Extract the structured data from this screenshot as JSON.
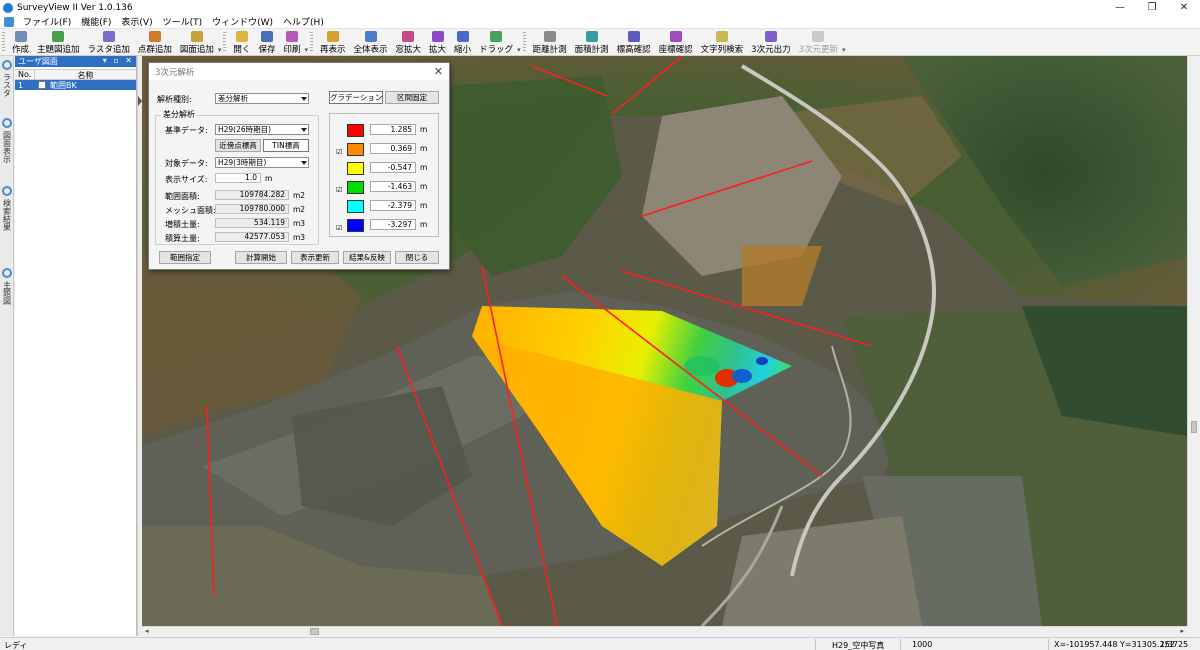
{
  "window": {
    "title": "SurveyView II  Ver 1.0.136",
    "controls": [
      "—",
      "❐",
      "✕"
    ]
  },
  "menu": [
    "ファイル(F)",
    "機能(F)",
    "表示(V)",
    "ツール(T)",
    "ウィンドウ(W)",
    "ヘルプ(H)"
  ],
  "toolbar": {
    "groups": [
      [
        {
          "label": "作成",
          "icon": "new-file-icon",
          "color": "#6f8fb8"
        },
        {
          "label": "主題図追加",
          "icon": "add-map-icon",
          "color": "#4aa04a"
        },
        {
          "label": "ラスタ追加",
          "icon": "add-raster-icon",
          "color": "#7a6cc8"
        },
        {
          "label": "点群追加",
          "icon": "add-pointcloud-icon",
          "color": "#d07a2a"
        },
        {
          "label": "図面追加",
          "icon": "add-drawing-icon",
          "color": "#c9a23a"
        }
      ],
      [
        {
          "label": "開く",
          "icon": "open-folder-icon",
          "color": "#e0b440"
        },
        {
          "label": "保存",
          "icon": "save-icon",
          "color": "#4a6fb8"
        },
        {
          "label": "印刷",
          "icon": "print-icon",
          "color": "#b45ab8"
        }
      ],
      [
        {
          "label": "再表示",
          "icon": "refresh-icon",
          "color": "#d8a030"
        },
        {
          "label": "全体表示",
          "icon": "fit-all-icon",
          "color": "#4a7fc8"
        },
        {
          "label": "窓拡大",
          "icon": "window-zoom-icon",
          "color": "#c84a8a"
        },
        {
          "label": "拡大",
          "icon": "zoom-in-icon",
          "color": "#8a4ac8"
        },
        {
          "label": "縮小",
          "icon": "zoom-out-icon",
          "color": "#4a6ac8"
        },
        {
          "label": "ドラッグ",
          "icon": "pan-drag-icon",
          "color": "#4aa060"
        }
      ],
      [
        {
          "label": "距離計測",
          "icon": "distance-measure-icon",
          "color": "#8a8a8a"
        },
        {
          "label": "面積計測",
          "icon": "area-measure-icon",
          "color": "#3a9aa8"
        },
        {
          "label": "標高確認",
          "icon": "elevation-check-icon",
          "color": "#5a5ac0"
        },
        {
          "label": "座標確認",
          "icon": "coordinate-check-icon",
          "color": "#a04ac0"
        },
        {
          "label": "文字列検索",
          "icon": "text-search-icon",
          "color": "#c8b850"
        },
        {
          "label": "3次元出力",
          "icon": "export-3d-icon",
          "color": "#8060c8"
        },
        {
          "label": "3次元更新",
          "icon": "update-3d-icon",
          "color": "#9a9a9a",
          "disabled": true
        }
      ]
    ]
  },
  "side_tabs": [
    "ラスタ",
    "図面表示",
    "検索結果",
    "主題図"
  ],
  "user_panel": {
    "title": "ユーザ図面",
    "buttons": "▾ ▫ ✕",
    "col_no": "No.",
    "col_name": "名称",
    "rows": [
      {
        "no": "1",
        "name": "範囲BK"
      }
    ]
  },
  "dialog": {
    "title": "3次元解析",
    "analysis_type_label": "解析種別:",
    "analysis_type_value": "差分解析",
    "tab_gradation": "グラデーション",
    "tab_zone_fixed": "区間固定",
    "section_title": "差分解析",
    "base_data_label": "基準データ:",
    "base_data_value": "H29(26時期目)",
    "nearest_elevation": "近傍点標高",
    "tin_elevation": "TIN標高",
    "target_data_label": "対象データ:",
    "target_data_value": "H29(3時期目)",
    "display_size_label": "表示サイズ:",
    "display_size_value": "1.0",
    "display_size_unit": "m",
    "stats": [
      {
        "label": "範囲面積:",
        "value": "109784.282",
        "unit": "m2"
      },
      {
        "label": "メッシュ面積:",
        "value": "109780.000",
        "unit": "m2"
      },
      {
        "label": "増積土量:",
        "value": "534.119",
        "unit": "m3"
      },
      {
        "label": "積算土量:",
        "value": "42577.053",
        "unit": "m3"
      }
    ],
    "legend": [
      {
        "color": "#ff0000",
        "value": "1.285",
        "unit": "m",
        "checked": false
      },
      {
        "color": "#ff8a00",
        "value": "0.369",
        "unit": "m",
        "checked": true
      },
      {
        "color": "#ffff00",
        "value": "-0.547",
        "unit": "m",
        "checked": false
      },
      {
        "color": "#00dd00",
        "value": "-1.463",
        "unit": "m",
        "checked": true
      },
      {
        "color": "#00ffff",
        "value": "-2.379",
        "unit": "m",
        "checked": false
      },
      {
        "color": "#0000ff",
        "value": "-3.297",
        "unit": "m",
        "checked": true
      }
    ],
    "buttons": [
      "範囲指定",
      "計算開始",
      "表示更新",
      "結果&反映",
      "閉じる"
    ]
  },
  "status": {
    "ready": "レディ",
    "layer": "H29_空中写真",
    "scale": "1000",
    "coords": "X=-101957.448  Y=31305.252",
    "page": "1/3725"
  }
}
